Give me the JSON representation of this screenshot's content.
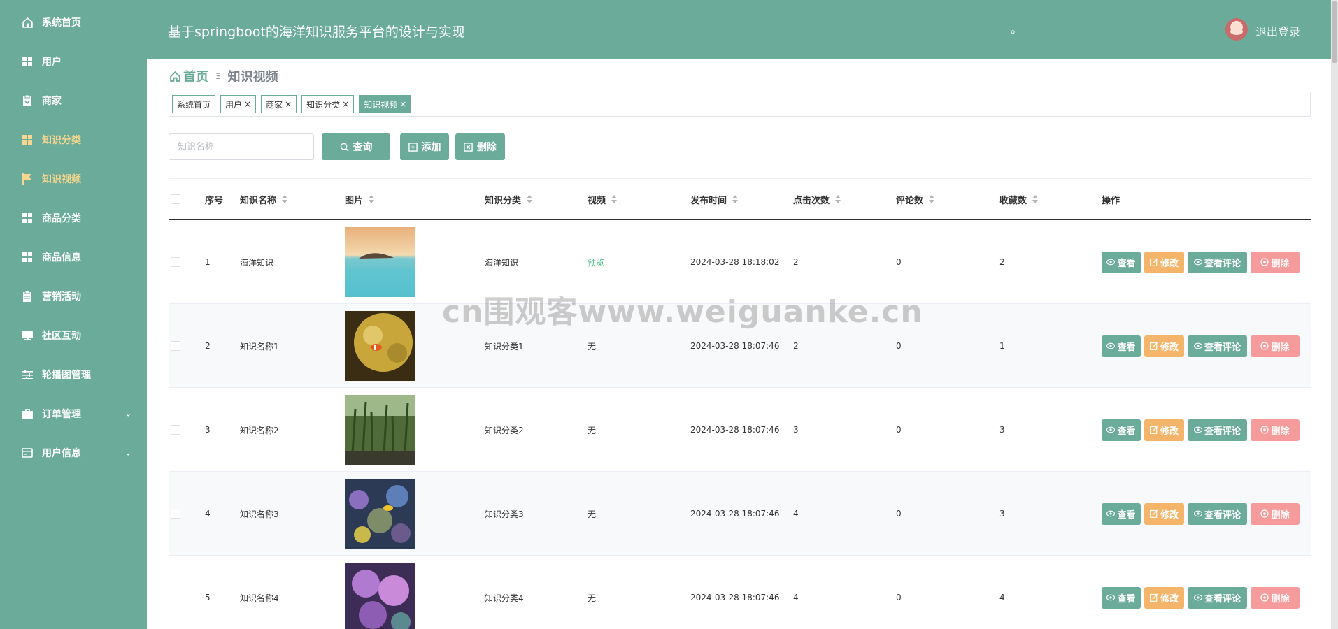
{
  "app": {
    "title": "基于springboot的海洋知识服务平台的设计与实现",
    "header_dot": "。",
    "logout_label": "退出登录"
  },
  "sidebar": {
    "items": [
      {
        "label": "系统首页",
        "icon": "home-icon"
      },
      {
        "label": "用户",
        "icon": "grid-icon"
      },
      {
        "label": "商家",
        "icon": "clipboard-icon"
      },
      {
        "label": "知识分类",
        "icon": "grid-icon"
      },
      {
        "label": "知识视频",
        "icon": "flag-icon"
      },
      {
        "label": "商品分类",
        "icon": "grid-icon"
      },
      {
        "label": "商品信息",
        "icon": "grid-icon"
      },
      {
        "label": "营销活动",
        "icon": "clipboard-icon"
      },
      {
        "label": "社区互动",
        "icon": "monitor-icon"
      },
      {
        "label": "轮播图管理",
        "icon": "sliders-icon"
      },
      {
        "label": "订单管理",
        "icon": "briefcase-icon"
      },
      {
        "label": "用户信息",
        "icon": "card-icon"
      }
    ],
    "active_colors": {
      "active": "#f6d78d",
      "normal": "#ffffff"
    }
  },
  "breadcrumb": {
    "home": "首页",
    "separator": "Ξ",
    "current": "知识视频"
  },
  "tags": [
    {
      "label": "系统首页"
    },
    {
      "label": "用户",
      "close": "×"
    },
    {
      "label": "商家",
      "close": "×"
    },
    {
      "label": "知识分类",
      "close": "×"
    },
    {
      "label": "知识视频",
      "close": "×"
    }
  ],
  "search": {
    "placeholder": "知识名称",
    "query_label": "查询",
    "add_label": "添加",
    "delete_label": "删除"
  },
  "table": {
    "headers": {
      "index": "序号",
      "name": "知识名称",
      "image": "图片",
      "category": "知识分类",
      "video": "视频",
      "time": "发布时间",
      "clicks": "点击次数",
      "comments": "评论数",
      "favorites": "收藏数",
      "ops": "操作"
    },
    "op_labels": {
      "view": "查看",
      "edit": "修改",
      "comments": "查看评论",
      "delete": "删除"
    },
    "rows": [
      {
        "index": "1",
        "name": "海洋知识",
        "category": "海洋知识",
        "video": "预览",
        "time": "2024-03-28 18:18:02",
        "clicks": "2",
        "comments": "0",
        "favorites": "2"
      },
      {
        "index": "2",
        "name": "知识名称1",
        "category": "知识分类1",
        "video": "无",
        "time": "2024-03-28 18:07:46",
        "clicks": "2",
        "comments": "0",
        "favorites": "1"
      },
      {
        "index": "3",
        "name": "知识名称2",
        "category": "知识分类2",
        "video": "无",
        "time": "2024-03-28 18:07:46",
        "clicks": "3",
        "comments": "0",
        "favorites": "3"
      },
      {
        "index": "4",
        "name": "知识名称3",
        "category": "知识分类3",
        "video": "无",
        "time": "2024-03-28 18:07:46",
        "clicks": "4",
        "comments": "0",
        "favorites": "3"
      },
      {
        "index": "5",
        "name": "知识名称4",
        "category": "知识分类4",
        "video": "无",
        "time": "2024-03-28 18:07:46",
        "clicks": "4",
        "comments": "0",
        "favorites": "4"
      }
    ]
  },
  "watermark": "cn围观客www.weiguanke.cn",
  "colors": {
    "primary": "#6aab9a",
    "warning": "#f4b46a",
    "danger": "#f59b9b",
    "link": "#42b983"
  }
}
